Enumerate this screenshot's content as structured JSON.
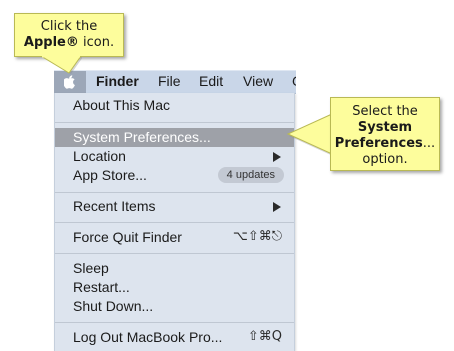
{
  "callouts": {
    "apple": {
      "line1": "Click the",
      "strong": "Apple®",
      "rest": " icon."
    },
    "sysprefs": {
      "line1": "Select the",
      "strong1": "System",
      "strong2": "Preferences",
      "ellipsis": "...",
      "line4": "option."
    }
  },
  "menubar": {
    "items": [
      {
        "label": "Finder"
      },
      {
        "label": "File"
      },
      {
        "label": "Edit"
      },
      {
        "label": "View"
      },
      {
        "label": "G"
      }
    ]
  },
  "apple_menu": {
    "about": "About This Mac",
    "system_prefs": "System Preferences...",
    "location": "Location",
    "app_store": "App Store...",
    "app_store_badge": "4 updates",
    "recent_items": "Recent Items",
    "force_quit": "Force Quit Finder",
    "force_quit_shortcut": "⌥⇧⌘⎋",
    "sleep": "Sleep",
    "restart": "Restart...",
    "shut_down": "Shut Down...",
    "log_out": "Log Out MacBook Pro...",
    "log_out_shortcut": "⇧⌘Q"
  },
  "colors": {
    "callout_fill": "#fdfd9c",
    "menu_bg": "#dde4ee",
    "menubar_bg": "#c9d6e8",
    "selected_bg": "#9ea1a8"
  }
}
